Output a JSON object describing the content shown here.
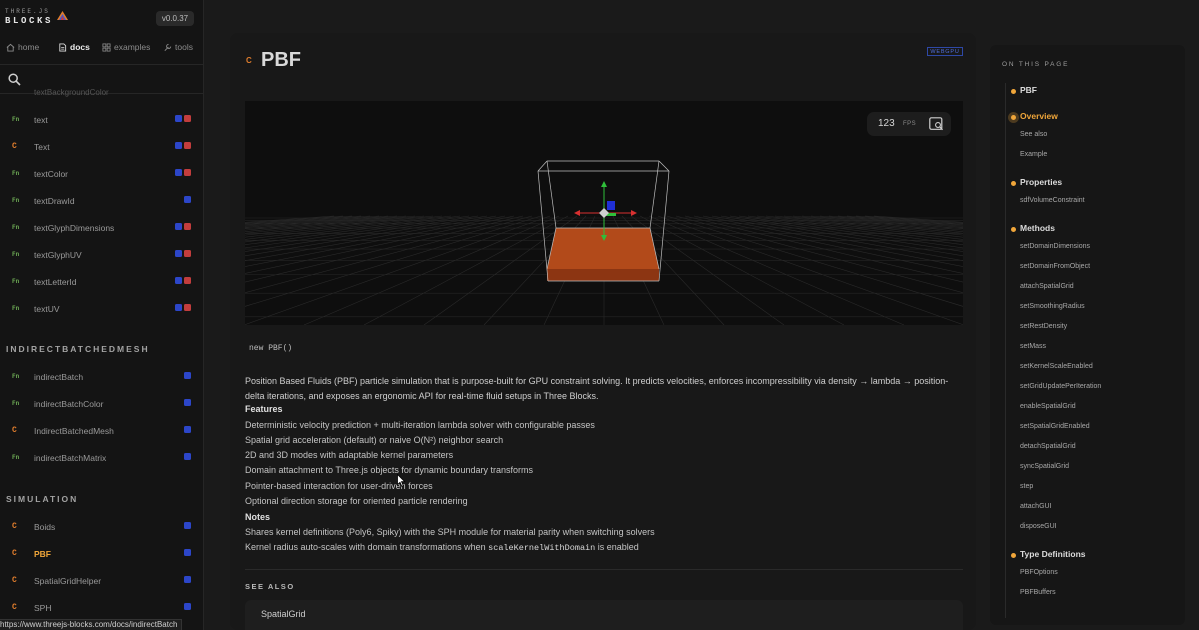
{
  "brand": {
    "small": "THREE.JS",
    "big": "BLOCKS",
    "version": "v0.0.37"
  },
  "nav": [
    {
      "label": "home",
      "icon": "home-icon"
    },
    {
      "label": "docs",
      "icon": "doc-icon",
      "active": true
    },
    {
      "label": "examples",
      "icon": "grid-icon"
    },
    {
      "label": "tools",
      "icon": "wrench-icon"
    }
  ],
  "search": {
    "placeholder": ""
  },
  "sidebar": {
    "clipped_label": "textBackgroundColor",
    "items_text": [
      {
        "kind": "Fn",
        "label": "text",
        "badges": [
          "blue",
          "red"
        ]
      },
      {
        "kind": "C",
        "label": "Text",
        "badges": [
          "blue",
          "red"
        ]
      },
      {
        "kind": "Fn",
        "label": "textColor",
        "badges": [
          "blue",
          "red"
        ]
      },
      {
        "kind": "Fn",
        "label": "textDrawId",
        "badges": [
          "blue"
        ]
      },
      {
        "kind": "Fn",
        "label": "textGlyphDimensions",
        "badges": [
          "blue",
          "red"
        ]
      },
      {
        "kind": "Fn",
        "label": "textGlyphUV",
        "badges": [
          "blue",
          "red"
        ]
      },
      {
        "kind": "Fn",
        "label": "textLetterId",
        "badges": [
          "blue",
          "red"
        ]
      },
      {
        "kind": "Fn",
        "label": "textUV",
        "badges": [
          "blue",
          "red"
        ]
      }
    ],
    "section_indirect": "INDIRECTBATCHEDMESH",
    "items_indirect": [
      {
        "kind": "Fn",
        "label": "indirectBatch",
        "badges": [
          "blue"
        ]
      },
      {
        "kind": "Fn",
        "label": "indirectBatchColor",
        "badges": [
          "blue"
        ]
      },
      {
        "kind": "C",
        "label": "IndirectBatchedMesh",
        "badges": [
          "blue"
        ]
      },
      {
        "kind": "Fn",
        "label": "indirectBatchMatrix",
        "badges": [
          "blue"
        ]
      }
    ],
    "section_simulation": "SIMULATION",
    "items_simulation": [
      {
        "kind": "C",
        "label": "Boids",
        "badges": [
          "blue"
        ]
      },
      {
        "kind": "C",
        "label": "PBF",
        "badges": [
          "blue"
        ],
        "active": true
      },
      {
        "kind": "C",
        "label": "SpatialGridHelper",
        "badges": [
          "blue"
        ]
      },
      {
        "kind": "C",
        "label": "SPH",
        "badges": [
          "blue"
        ]
      }
    ]
  },
  "main": {
    "badge": "WEBGPU",
    "kind": "C",
    "title": "PBF",
    "viewport": {
      "fps_value": "123",
      "fps_label": "FPS"
    },
    "code": "new PBF()",
    "description": "Position Based Fluids (PBF) particle simulation that is purpose-built for GPU constraint solving. It predicts velocities, enforces incompressibility via density → lambda → position-delta iterations, and exposes an ergonomic API for real-time fluid setups in Three Blocks.",
    "features_heading": "Features",
    "features": [
      "Deterministic velocity prediction + multi-iteration lambda solver with configurable passes",
      "Spatial grid acceleration (default) or naive O(N²) neighbor search",
      "2D and 3D modes with adaptable kernel parameters",
      "Domain attachment to Three.js objects for dynamic boundary transforms",
      "Pointer-based interaction for user-driven forces",
      "Optional direction storage for oriented particle rendering"
    ],
    "notes_heading": "Notes",
    "note1": "Shares kernel definitions (Poly6, Spiky) with the SPH module for material parity when switching solvers",
    "note2_pre": "Kernel radius auto-scales with domain transformations when ",
    "note2_code": "scaleKernelWithDomain",
    "note2_post": " is enabled",
    "see_also_heading": "SEE ALSO",
    "see_also_item": "SpatialGrid"
  },
  "toc": {
    "heading": "ON THIS PAGE",
    "entries": [
      {
        "type": "section",
        "label": "PBF"
      },
      {
        "type": "section",
        "label": "Overview",
        "active": true
      },
      {
        "type": "sub",
        "label": "See also"
      },
      {
        "type": "sub",
        "label": "Example"
      },
      {
        "type": "section",
        "label": "Properties"
      },
      {
        "type": "sub",
        "label": "sdfVolumeConstraint"
      },
      {
        "type": "section",
        "label": "Methods"
      },
      {
        "type": "sub",
        "label": "setDomainDimensions"
      },
      {
        "type": "sub",
        "label": "setDomainFromObject"
      },
      {
        "type": "sub",
        "label": "attachSpatialGrid"
      },
      {
        "type": "sub",
        "label": "setSmoothingRadius"
      },
      {
        "type": "sub",
        "label": "setRestDensity"
      },
      {
        "type": "sub",
        "label": "setMass"
      },
      {
        "type": "sub",
        "label": "setKernelScaleEnabled"
      },
      {
        "type": "sub",
        "label": "setGridUpdatePerIteration"
      },
      {
        "type": "sub",
        "label": "enableSpatialGrid"
      },
      {
        "type": "sub",
        "label": "setSpatialGridEnabled"
      },
      {
        "type": "sub",
        "label": "detachSpatialGrid"
      },
      {
        "type": "sub",
        "label": "syncSpatialGrid"
      },
      {
        "type": "sub",
        "label": "step"
      },
      {
        "type": "sub",
        "label": "attachGUI"
      },
      {
        "type": "sub",
        "label": "disposeGUI"
      },
      {
        "type": "section",
        "label": "Type Definitions"
      },
      {
        "type": "sub",
        "label": "PBFOptions"
      },
      {
        "type": "sub",
        "label": "PBFBuffers"
      }
    ]
  },
  "status_url": "https://www.threejs-blocks.com/docs/indirectBatch",
  "colors": {
    "accent": "#f0a63a",
    "class_kind": "#e07d2d",
    "fn_kind": "#6fae56",
    "webgpu_badge": "#2c46c9",
    "webgl_badge": "#c23d3d",
    "fluid": "#b24a1a"
  }
}
